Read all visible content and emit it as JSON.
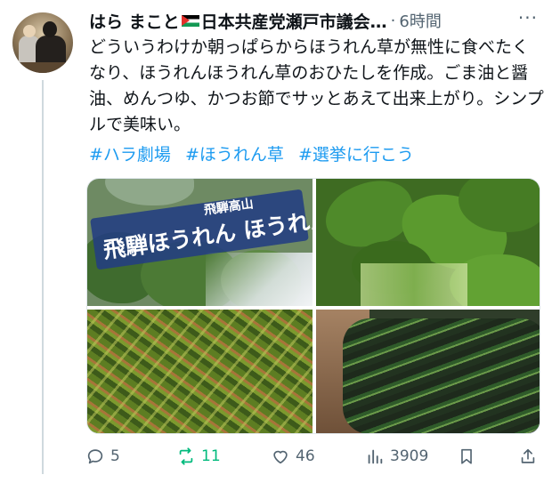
{
  "post": {
    "author_name": "はら まこと",
    "author_affiliation": "日本共産党瀬戸市議会…",
    "separator": "·",
    "time": "6時間",
    "more_label": "···",
    "body": "どういうわけか朝っぱらからほうれん草が無性に食べたくなり、ほうれんほうれん草のおひたしを作成。ごま油と醤油、めんつゆ、かつお節でサッとあえて出来上がり。シンプルで美味い。",
    "hashtags": [
      "#ハラ劇場",
      "#ほうれん草",
      "#選挙に行こう"
    ]
  },
  "media": {
    "photo1": {
      "label_small": "飛騨高山",
      "label_big": "飛騨ほうれん ほうれんそう"
    }
  },
  "actions": {
    "replies": "5",
    "reposts": "11",
    "likes": "46",
    "views": "3909"
  },
  "colors": {
    "link": "#1d9bf0",
    "repost_active": "#00ba7c",
    "muted": "#536471",
    "palestine_flag": [
      "#000000",
      "#ffffff",
      "#149954",
      "#e4312b"
    ]
  },
  "icons": {
    "reply": "speech-bubble-icon",
    "repost": "repost-arrows-icon",
    "like": "heart-icon",
    "views": "bar-chart-icon",
    "bookmark": "bookmark-icon",
    "share": "share-icon",
    "flag": "palestine-flag-icon"
  }
}
